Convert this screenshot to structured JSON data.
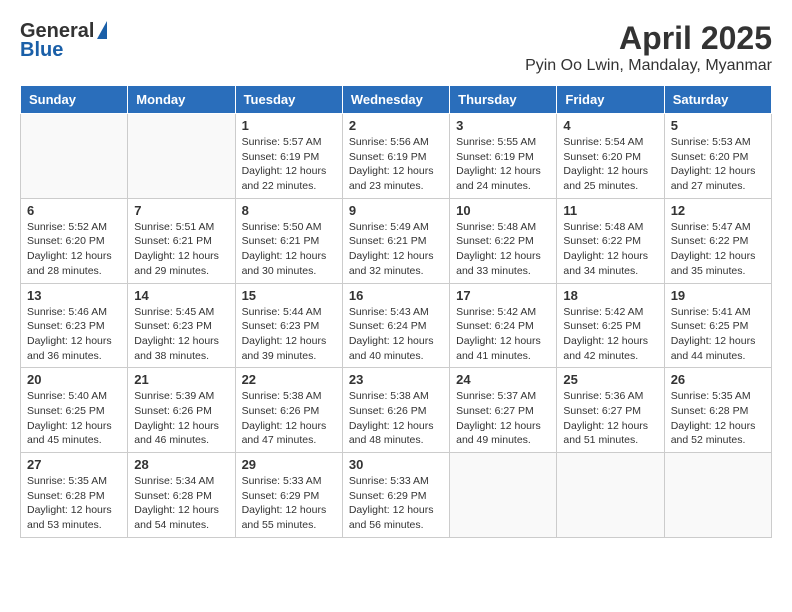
{
  "header": {
    "logo_general": "General",
    "logo_blue": "Blue",
    "title": "April 2025",
    "subtitle": "Pyin Oo Lwin, Mandalay, Myanmar"
  },
  "weekdays": [
    "Sunday",
    "Monday",
    "Tuesday",
    "Wednesday",
    "Thursday",
    "Friday",
    "Saturday"
  ],
  "weeks": [
    [
      {
        "day": "",
        "info": ""
      },
      {
        "day": "",
        "info": ""
      },
      {
        "day": "1",
        "info": "Sunrise: 5:57 AM\nSunset: 6:19 PM\nDaylight: 12 hours and 22 minutes."
      },
      {
        "day": "2",
        "info": "Sunrise: 5:56 AM\nSunset: 6:19 PM\nDaylight: 12 hours and 23 minutes."
      },
      {
        "day": "3",
        "info": "Sunrise: 5:55 AM\nSunset: 6:19 PM\nDaylight: 12 hours and 24 minutes."
      },
      {
        "day": "4",
        "info": "Sunrise: 5:54 AM\nSunset: 6:20 PM\nDaylight: 12 hours and 25 minutes."
      },
      {
        "day": "5",
        "info": "Sunrise: 5:53 AM\nSunset: 6:20 PM\nDaylight: 12 hours and 27 minutes."
      }
    ],
    [
      {
        "day": "6",
        "info": "Sunrise: 5:52 AM\nSunset: 6:20 PM\nDaylight: 12 hours and 28 minutes."
      },
      {
        "day": "7",
        "info": "Sunrise: 5:51 AM\nSunset: 6:21 PM\nDaylight: 12 hours and 29 minutes."
      },
      {
        "day": "8",
        "info": "Sunrise: 5:50 AM\nSunset: 6:21 PM\nDaylight: 12 hours and 30 minutes."
      },
      {
        "day": "9",
        "info": "Sunrise: 5:49 AM\nSunset: 6:21 PM\nDaylight: 12 hours and 32 minutes."
      },
      {
        "day": "10",
        "info": "Sunrise: 5:48 AM\nSunset: 6:22 PM\nDaylight: 12 hours and 33 minutes."
      },
      {
        "day": "11",
        "info": "Sunrise: 5:48 AM\nSunset: 6:22 PM\nDaylight: 12 hours and 34 minutes."
      },
      {
        "day": "12",
        "info": "Sunrise: 5:47 AM\nSunset: 6:22 PM\nDaylight: 12 hours and 35 minutes."
      }
    ],
    [
      {
        "day": "13",
        "info": "Sunrise: 5:46 AM\nSunset: 6:23 PM\nDaylight: 12 hours and 36 minutes."
      },
      {
        "day": "14",
        "info": "Sunrise: 5:45 AM\nSunset: 6:23 PM\nDaylight: 12 hours and 38 minutes."
      },
      {
        "day": "15",
        "info": "Sunrise: 5:44 AM\nSunset: 6:23 PM\nDaylight: 12 hours and 39 minutes."
      },
      {
        "day": "16",
        "info": "Sunrise: 5:43 AM\nSunset: 6:24 PM\nDaylight: 12 hours and 40 minutes."
      },
      {
        "day": "17",
        "info": "Sunrise: 5:42 AM\nSunset: 6:24 PM\nDaylight: 12 hours and 41 minutes."
      },
      {
        "day": "18",
        "info": "Sunrise: 5:42 AM\nSunset: 6:25 PM\nDaylight: 12 hours and 42 minutes."
      },
      {
        "day": "19",
        "info": "Sunrise: 5:41 AM\nSunset: 6:25 PM\nDaylight: 12 hours and 44 minutes."
      }
    ],
    [
      {
        "day": "20",
        "info": "Sunrise: 5:40 AM\nSunset: 6:25 PM\nDaylight: 12 hours and 45 minutes."
      },
      {
        "day": "21",
        "info": "Sunrise: 5:39 AM\nSunset: 6:26 PM\nDaylight: 12 hours and 46 minutes."
      },
      {
        "day": "22",
        "info": "Sunrise: 5:38 AM\nSunset: 6:26 PM\nDaylight: 12 hours and 47 minutes."
      },
      {
        "day": "23",
        "info": "Sunrise: 5:38 AM\nSunset: 6:26 PM\nDaylight: 12 hours and 48 minutes."
      },
      {
        "day": "24",
        "info": "Sunrise: 5:37 AM\nSunset: 6:27 PM\nDaylight: 12 hours and 49 minutes."
      },
      {
        "day": "25",
        "info": "Sunrise: 5:36 AM\nSunset: 6:27 PM\nDaylight: 12 hours and 51 minutes."
      },
      {
        "day": "26",
        "info": "Sunrise: 5:35 AM\nSunset: 6:28 PM\nDaylight: 12 hours and 52 minutes."
      }
    ],
    [
      {
        "day": "27",
        "info": "Sunrise: 5:35 AM\nSunset: 6:28 PM\nDaylight: 12 hours and 53 minutes."
      },
      {
        "day": "28",
        "info": "Sunrise: 5:34 AM\nSunset: 6:28 PM\nDaylight: 12 hours and 54 minutes."
      },
      {
        "day": "29",
        "info": "Sunrise: 5:33 AM\nSunset: 6:29 PM\nDaylight: 12 hours and 55 minutes."
      },
      {
        "day": "30",
        "info": "Sunrise: 5:33 AM\nSunset: 6:29 PM\nDaylight: 12 hours and 56 minutes."
      },
      {
        "day": "",
        "info": ""
      },
      {
        "day": "",
        "info": ""
      },
      {
        "day": "",
        "info": ""
      }
    ]
  ]
}
